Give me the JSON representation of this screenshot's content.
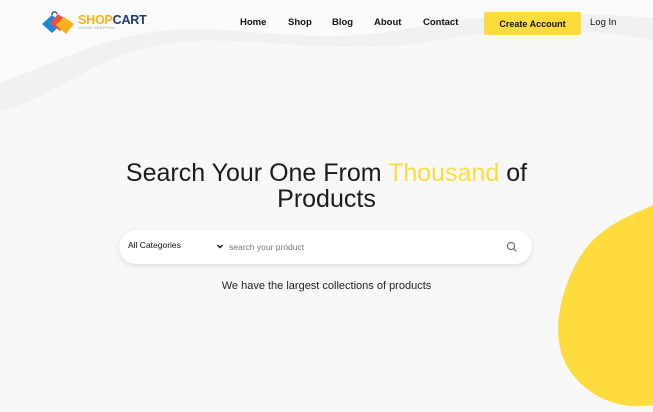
{
  "brand": {
    "name_part1": "SHOP",
    "name_part2": "CART",
    "tagline": "ONLINE SHOPPING",
    "colors": {
      "shop": "#f5b21c",
      "cart": "#1b3a6b"
    }
  },
  "nav": {
    "items": [
      {
        "label": "Home"
      },
      {
        "label": "Shop"
      },
      {
        "label": "Blog"
      },
      {
        "label": "About"
      },
      {
        "label": "Contact"
      }
    ],
    "create_account_label": "Create Account",
    "login_label": "Log In"
  },
  "hero": {
    "title_before": "Search Your One From ",
    "title_accent": "Thousand",
    "title_after": " of",
    "title_line2": "Products",
    "subtitle": "We have the largest collections of products"
  },
  "search": {
    "category_selected": "All Categories",
    "placeholder": "search your product",
    "icon": "search-icon",
    "chevron_icon": "chevron-down-icon"
  },
  "colors": {
    "accent": "#fedc3d",
    "background": "#f8f8f8",
    "text": "#1b1b1b"
  }
}
